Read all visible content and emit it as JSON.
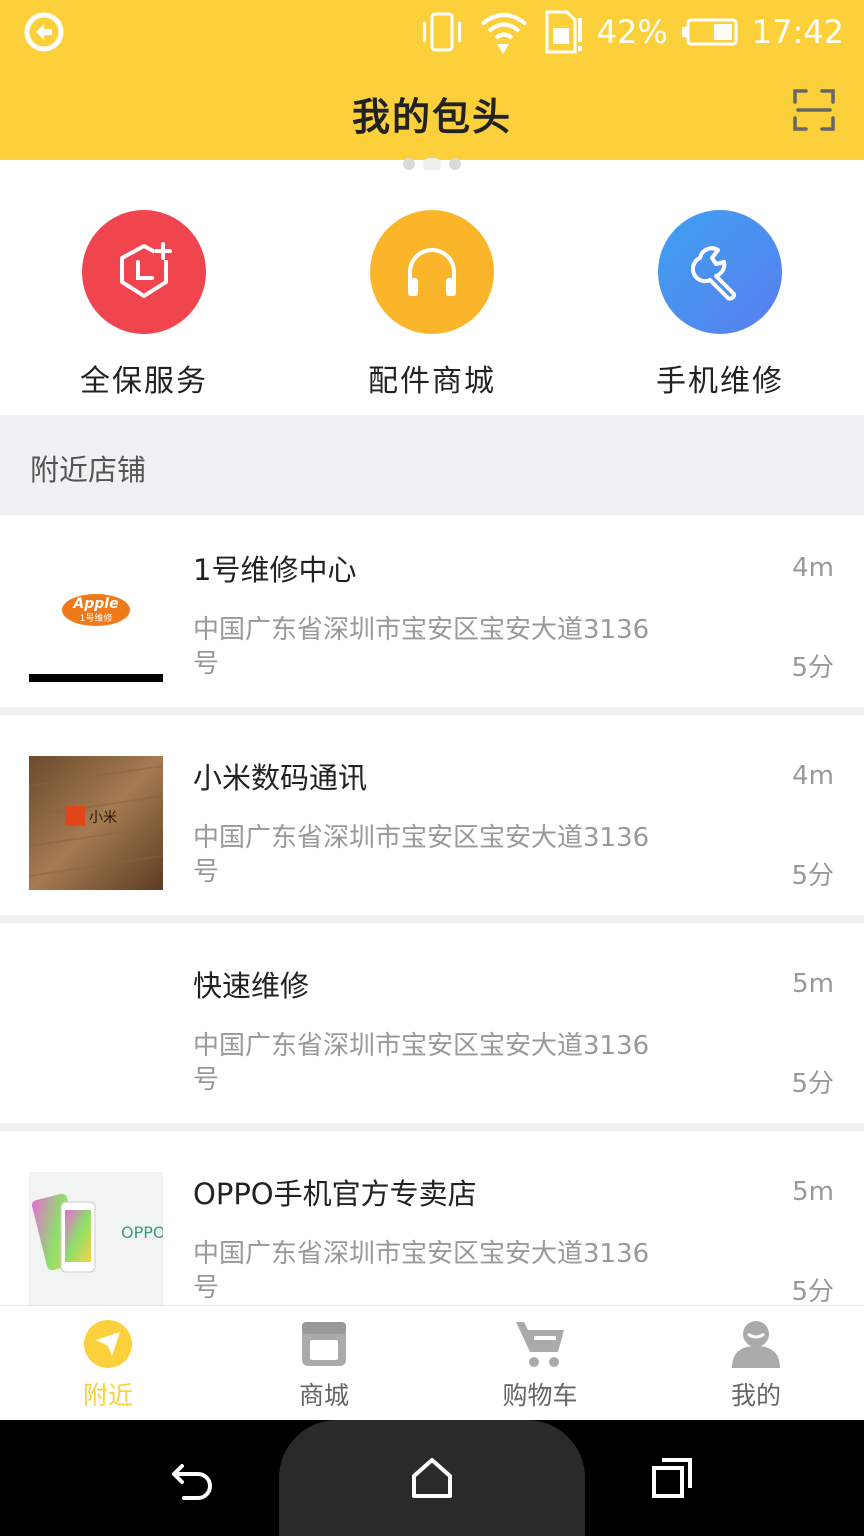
{
  "status_bar": {
    "battery": "42%",
    "time": "17:42"
  },
  "header": {
    "title": "我的包头",
    "scan_icon": "scan-icon"
  },
  "carousel": {
    "pages": 3,
    "active": 2
  },
  "services": [
    {
      "label": "全保服务",
      "icon": "shield-plus-icon",
      "color": "#f0444f"
    },
    {
      "label": "配件商城",
      "icon": "headphones-icon",
      "color": "#fbb52a"
    },
    {
      "label": "手机维修",
      "icon": "wrench-icon",
      "color": "#4f8cf1"
    }
  ],
  "section": {
    "title": "附近店铺"
  },
  "stores": [
    {
      "name": "1号维修中心",
      "address": "中国广东省深圳市宝安区宝安大道3136号",
      "distance": "4m",
      "time": "5分",
      "logo_text": "Apple 1号维修"
    },
    {
      "name": "小米数码通讯",
      "address": "中国广东省深圳市宝安区宝安大道3136号",
      "distance": "4m",
      "time": "5分",
      "logo_text": "小米"
    },
    {
      "name": "快速维修",
      "address": "中国广东省深圳市宝安区宝安大道3136号",
      "distance": "5m",
      "time": "5分"
    },
    {
      "name": "OPPO手机官方专卖店",
      "address": "中国广东省深圳市宝安区宝安大道3136号",
      "distance": "5m",
      "time": "5分",
      "logo_text": "OPPO"
    }
  ],
  "tabs": [
    {
      "label": "附近",
      "icon": "nearby-icon",
      "active": true
    },
    {
      "label": "商城",
      "icon": "store-icon",
      "active": false
    },
    {
      "label": "购物车",
      "icon": "cart-icon",
      "active": false
    },
    {
      "label": "我的",
      "icon": "profile-icon",
      "active": false
    }
  ],
  "colors": {
    "brand": "#fcd03b",
    "background": "#eff1f3"
  }
}
